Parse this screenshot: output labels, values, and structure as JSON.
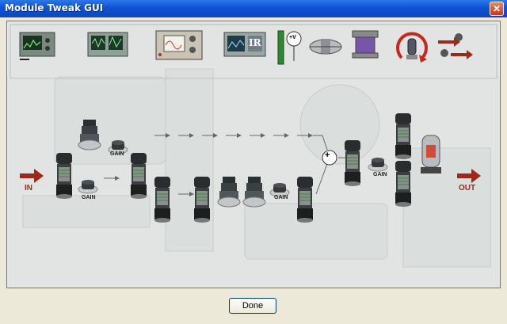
{
  "window": {
    "title": "Module Tweak GUI",
    "close_label": "✕"
  },
  "toolbar": {
    "voltage_label": "+V",
    "ir_label": "IR"
  },
  "circuit": {
    "in_label": "IN",
    "out_label": "OUT",
    "gain_labels": [
      "GAIN",
      "GAIN",
      "GAIN",
      "GAIN"
    ],
    "sum_label": "+"
  },
  "footer": {
    "done_label": "Done"
  },
  "colors": {
    "accent": "#a02818",
    "titlebar": "#0e52d4",
    "meter_green": "#2e8a2e"
  }
}
